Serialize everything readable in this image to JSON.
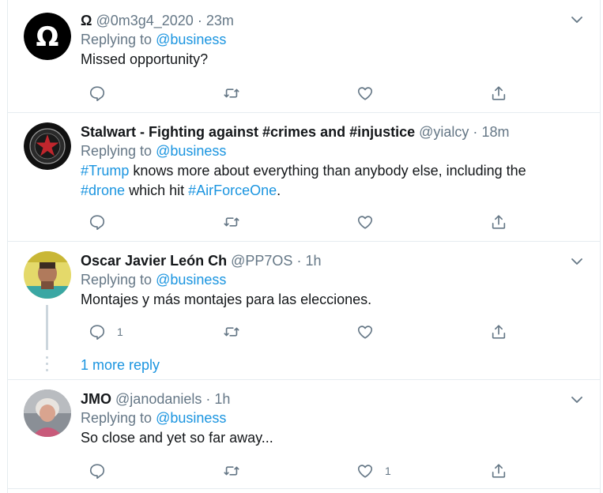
{
  "tweets": [
    {
      "name": "Ω",
      "handle": "@0m3g4_2020",
      "time": "23m",
      "reply_prefix": "Replying to",
      "reply_to": "@business",
      "text_parts": [
        "Missed opportunity?"
      ],
      "reply_count": "",
      "retweet_count": "",
      "like_count": ""
    },
    {
      "name": "Stalwart - Fighting against #crimes and #injustice",
      "handle": "@yialcy",
      "time": "18m",
      "reply_prefix": "Replying to",
      "reply_to": "@business",
      "line1": {
        "tag1": "#Trump",
        "text1": " knows more about everything than anybody else, including the"
      },
      "line2": {
        "tag1": "#drone",
        "text1": " which hit ",
        "tag2": "#AirForceOne",
        "text2": "."
      },
      "reply_count": "",
      "retweet_count": "",
      "like_count": ""
    },
    {
      "name": "Oscar Javier León Ch",
      "handle": "@PP7OS",
      "time": "1h",
      "reply_prefix": "Replying to",
      "reply_to": "@business",
      "text": "Montajes y más montajes para las elecciones.",
      "reply_count": "1",
      "retweet_count": "",
      "like_count": ""
    },
    {
      "name": "JMO",
      "handle": "@janodaniels",
      "time": "1h",
      "reply_prefix": "Replying to",
      "reply_to": "@business",
      "text": "So close and yet so far away...",
      "reply_count": "",
      "retweet_count": "",
      "like_count": "1"
    }
  ],
  "more_replies": "1 more reply",
  "separator": "·",
  "colors": {
    "link": "#1b95e0",
    "muted": "#657786",
    "border": "#e6ecf0",
    "thread": "#ccd6dd"
  },
  "icons": [
    "reply-icon",
    "retweet-icon",
    "like-icon",
    "share-icon",
    "chevron-down-icon"
  ]
}
